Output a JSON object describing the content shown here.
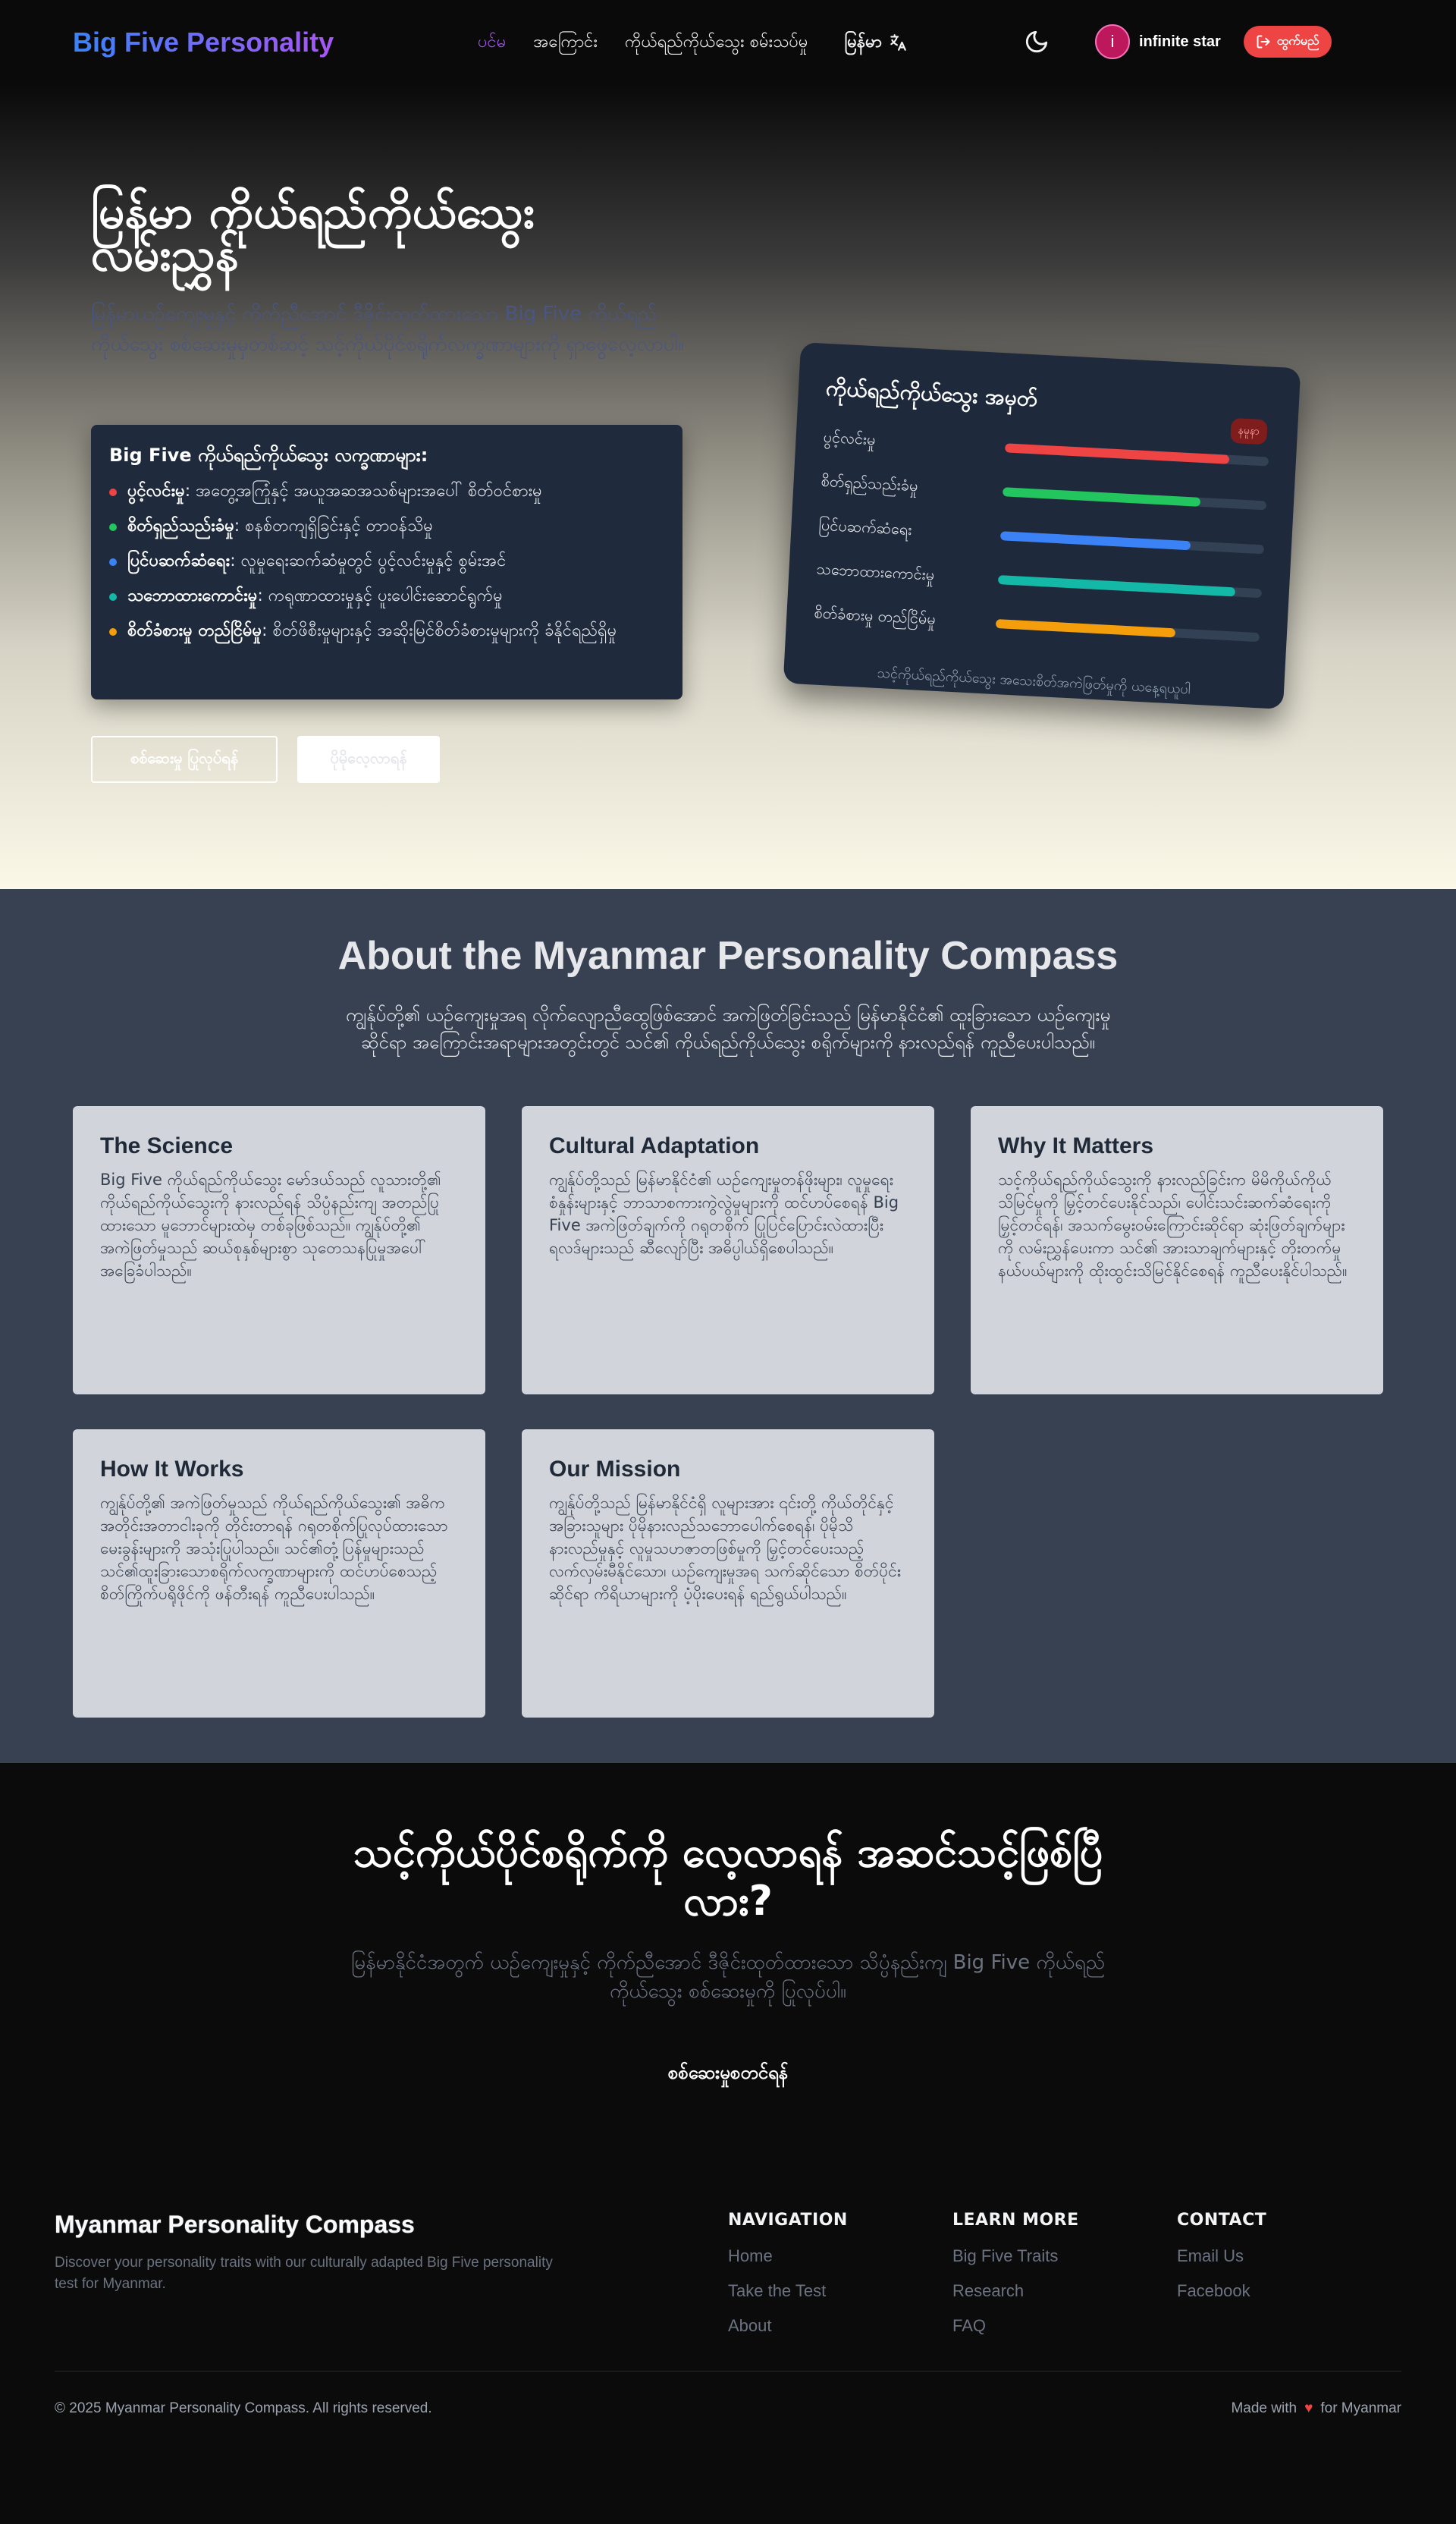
{
  "nav": {
    "brand": "Big Five Personality",
    "links": [
      "ပင်မ",
      "အကြောင်း",
      "ကိုယ်ရည်ကိုယ်သွေး စမ်းသပ်မှု"
    ],
    "lang_label": "မြန်မာ",
    "lang_icon": "translate-icon",
    "theme_icon": "moon-icon",
    "user": {
      "initial": "i",
      "name": "infinite star"
    },
    "logout_label": "ထွက်မည်",
    "colors": {
      "active": "#a855f7",
      "logout": "#ef4444"
    }
  },
  "hero": {
    "title": "မြန်မာ ကိုယ်ရည်ကိုယ်သွေး လမ်းညွှန်",
    "subtitle": "မြန်မာယဉ်ကျေးမှုနှင့် ကိုက်ညီအောင် ဒီဇိုင်းထုတ်ထားသော Big Five ကိုယ်ရည်ကိုယ်သွေး စစ်ဆေးမှုမှတစ်ဆင့် သင့်ကိုယ်ပိုင်စရိုက်လက္ခဏာများကို ရှာဖွေလေ့လာပါ။",
    "traits_title": "Big Five ကိုယ်ရည်ကိုယ်သွေး လက္ခဏာများ:",
    "traits": [
      {
        "name": "ပွင့်လင်းမှု",
        "desc": ": အတွေ့အကြုံနှင့် အယူအဆအသစ်များအပေါ် စိတ်ဝင်စားမှု",
        "color": "#ef4444"
      },
      {
        "name": "စိတ်ရှည်သည်းခံမှု",
        "desc": ": စနစ်တကျရှိခြင်းနှင့် တာဝန်သိမှု",
        "color": "#22c55e"
      },
      {
        "name": "ပြင်ပဆက်ဆံရေး",
        "desc": ": လူမှုရေးဆက်ဆံမှုတွင် ပွင့်လင်းမှုနှင့် စွမ်းအင်",
        "color": "#3b82f6"
      },
      {
        "name": "သဘောထားကောင်းမှု",
        "desc": ": ကရုဏာထားမှုနှင့် ပူးပေါင်းဆောင်ရွက်မှု",
        "color": "#14b8a6"
      },
      {
        "name": "စိတ်ခံစားမှု တည်ငြိမ်မှု",
        "desc": ": စိတ်ဖိစီးမှုများနှင့် အဆိုးမြင်စိတ်ခံစားမှုများကို ခံနိုင်ရည်ရှိမှု",
        "color": "#f59e0b"
      }
    ],
    "start_button": "စစ်ဆေးမှု ပြုလုပ်ရန်",
    "more_button": "ပိုမိုလေ့လာရန်"
  },
  "trait_card": {
    "title": "ကိုယ်ရည်ကိုယ်သွေး အမှတ်",
    "badge": "နမူနာ",
    "rows": [
      {
        "label": "ပွင့်လင်းမှု",
        "value": 0.85,
        "color": "#ef4444"
      },
      {
        "label": "စိတ်ရှည်သည်းခံမှု",
        "value": 0.75,
        "color": "#22c55e"
      },
      {
        "label": "ပြင်ပဆက်ဆံရေး",
        "value": 0.72,
        "color": "#3b82f6"
      },
      {
        "label": "သဘောထားကောင်းမှု",
        "value": 0.9,
        "color": "#14b8a6"
      },
      {
        "label": "စိတ်ခံစားမှု တည်ငြိမ်မှု",
        "value": 0.68,
        "color": "#f59e0b"
      }
    ],
    "footer": "သင့်ကိုယ်ရည်ကိုယ်သွေး အသေးစိတ်အကဲဖြတ်မှုကို ယနေ့ရယူပါ"
  },
  "about": {
    "title": "About the Myanmar Personality Compass",
    "subtitle": "ကျွန်ုပ်တို့၏ ယဉ်ကျေးမှုအရ လိုက်လျောညီထွေဖြစ်အောင် အကဲဖြတ်ခြင်းသည် မြန်မာနိုင်ငံ၏ ထူးခြားသော ယဉ်ကျေးမှုဆိုင်ရာ အကြောင်းအရာများအတွင်းတွင် သင်၏ ကိုယ်ရည်ကိုယ်သွေး စရိုက်များကို နားလည်ရန် ကူညီပေးပါသည်။",
    "cards": [
      {
        "title": "The Science",
        "body": "Big Five ကိုယ်ရည်ကိုယ်သွေး မော်ဒယ်သည် လူသားတို့၏ ကိုယ်ရည်ကိုယ်သွေးကို နားလည်ရန် သိပ္ပံနည်းကျ အတည်ပြုထားသော မူဘောင်များထဲမှ တစ်ခုဖြစ်သည်။ ကျွန်ုပ်တို့၏ အကဲဖြတ်မှုသည် ဆယ်စုနှစ်များစွာ သုတေသနပြုမှုအပေါ် အခြေခံပါသည်။"
      },
      {
        "title": "Cultural Adaptation",
        "body": "ကျွန်ုပ်တို့သည် မြန်မာနိုင်ငံ၏ ယဉ်ကျေးမှုတန်ဖိုးများ၊ လူမှုရေးစံနှုန်းများနှင့် ဘာသာစကားကွဲလွဲမှုများကို ထင်ဟပ်စေရန် Big Five အကဲဖြတ်ချက်ကို ဂရုတစိုက် ပြုပြင်ပြောင်းလဲထားပြီး ရလဒ်များသည် ဆီလျော်ပြီး အဓိပ္ပါယ်ရှိစေပါသည်။"
      },
      {
        "title": "Why It Matters",
        "body": "သင့်ကိုယ်ရည်ကိုယ်သွေးကို နားလည်ခြင်းက မိမိကိုယ်ကိုယ်သိမြင်မှုကို မြှင့်တင်ပေးနိုင်သည်၊ ပေါင်းသင်းဆက်ဆံရေးကို မြှင့်တင်ရန်၊ အသက်မွေးဝမ်းကြောင်းဆိုင်ရာ ဆုံးဖြတ်ချက်များကို လမ်းညွှန်ပေးကာ သင်၏ အားသာချက်များနှင့် တိုးတက်မှုနယ်ပယ်များကို ထိုးထွင်းသိမြင်နိုင်စေရန် ကူညီပေးနိုင်ပါသည်။"
      },
      {
        "title": "How It Works",
        "body": "ကျွန်ုပ်တို့၏ အကဲဖြတ်မှုသည် ကိုယ်ရည်ကိုယ်သွေး၏ အဓိက အတိုင်းအတာငါးခုကို တိုင်းတာရန် ဂရုတစိုက်ပြုလုပ်ထားသော မေးခွန်းများကို အသုံးပြုပါသည်။ သင်၏တုံ့ပြန်မှုများသည် သင်၏ထူးခြားသောစရိုက်လက္ခဏာများကို ထင်ဟပ်စေသည့် စိတ်ကြိုက်ပရိုဖိုင်ကို ဖန်တီးရန် ကူညီပေးပါသည်။"
      },
      {
        "title": "Our Mission",
        "body": "ကျွန်ုပ်တို့သည် မြန်မာနိုင်ငံရှိ လူများအား ၎င်းတို့ ကိုယ်တိုင်နှင့် အခြားသူများ ပိုမိုနားလည်သဘောပေါက်စေရန်၊ ပိုမိုသိနားလည်မှုနှင့် လူမှုသဟဇာတဖြစ်မှုကို မြှင့်တင်ပေးသည့် လက်လှမ်းမီနိုင်သော၊ ယဉ်ကျေးမှုအရ သက်ဆိုင်သော စိတ်ပိုင်းဆိုင်ရာ ကိရိယာများကို ပံ့ပိုးပေးရန် ရည်ရွယ်ပါသည်။"
      }
    ]
  },
  "cta": {
    "title": "သင့်ကိုယ်ပိုင်စရိုက်ကို လေ့လာရန် အဆင်သင့်ဖြစ်ပြီလား?",
    "subtitle": "မြန်မာနိုင်ငံအတွက် ယဉ်ကျေးမှုနှင့် ကိုက်ညီအောင် ဒီဇိုင်းထုတ်ထားသော သိပ္ပံနည်းကျ Big Five ကိုယ်ရည်ကိုယ်သွေး စစ်ဆေးမှုကို ပြုလုပ်ပါ။",
    "button": "စစ်ဆေးမှုစတင်ရန်"
  },
  "footer": {
    "brand": "Myanmar Personality Compass",
    "tagline": "Discover your personality traits with our culturally adapted Big Five personality test for Myanmar.",
    "columns": [
      {
        "title": "NAVIGATION",
        "links": [
          "Home",
          "Take the Test",
          "About"
        ]
      },
      {
        "title": "LEARN MORE",
        "links": [
          "Big Five Traits",
          "Research",
          "FAQ"
        ]
      },
      {
        "title": "CONTACT",
        "links": [
          "Email Us",
          "Facebook"
        ]
      }
    ],
    "copyright": "© 2025 Myanmar Personality Compass. All rights reserved.",
    "made_with": "Made with",
    "for": "for Myanmar"
  }
}
